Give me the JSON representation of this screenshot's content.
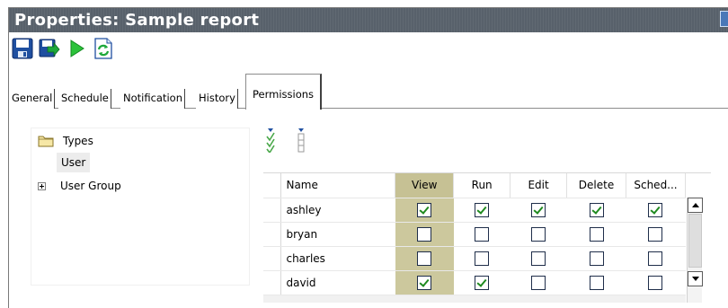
{
  "window": {
    "title": "Properties: Sample report"
  },
  "toolbar": {
    "buttons": [
      {
        "name": "save-icon"
      },
      {
        "name": "save-and-close-icon"
      },
      {
        "name": "run-icon"
      },
      {
        "name": "refresh-icon"
      }
    ]
  },
  "tabs": [
    {
      "label": "General"
    },
    {
      "label": "Schedule"
    },
    {
      "label": "Notification"
    },
    {
      "label": "History"
    },
    {
      "label": "Permissions",
      "active": true
    }
  ],
  "tree": {
    "root_label": "Types",
    "selected_label": "User",
    "group_label": "User Group"
  },
  "grid": {
    "columns": [
      "Name",
      "View",
      "Run",
      "Edit",
      "Delete",
      "Sched..."
    ],
    "rows": [
      {
        "name": "ashley",
        "perms": [
          true,
          true,
          true,
          true,
          true
        ]
      },
      {
        "name": "bryan",
        "perms": [
          false,
          false,
          false,
          false,
          false
        ]
      },
      {
        "name": "charles",
        "perms": [
          false,
          false,
          false,
          false,
          false
        ]
      },
      {
        "name": "david",
        "perms": [
          true,
          true,
          false,
          false,
          false
        ]
      }
    ]
  },
  "colors": {
    "titlebar": "#58616b",
    "view_column": "#ccc89d",
    "check_green": "#1f8a1f",
    "toolbar_blue": "#1f4fa0",
    "toolbar_green": "#1ea83a"
  }
}
